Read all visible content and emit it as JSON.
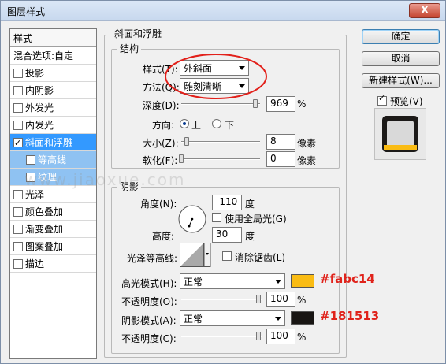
{
  "window": {
    "title": "图层样式",
    "close_glyph": "X"
  },
  "stylelist": {
    "header": "样式",
    "blend_options": "混合选项:自定",
    "items": [
      {
        "label": "投影",
        "checked": false
      },
      {
        "label": "内阴影",
        "checked": false
      },
      {
        "label": "外发光",
        "checked": false
      },
      {
        "label": "内发光",
        "checked": false
      },
      {
        "label": "斜面和浮雕",
        "checked": true,
        "active": true
      },
      {
        "label": "等高线",
        "checked": false,
        "sub": true
      },
      {
        "label": "纹理",
        "checked": false,
        "sub": true
      },
      {
        "label": "光泽",
        "checked": false
      },
      {
        "label": "颜色叠加",
        "checked": false
      },
      {
        "label": "渐变叠加",
        "checked": false
      },
      {
        "label": "图案叠加",
        "checked": false
      },
      {
        "label": "描边",
        "checked": false
      }
    ]
  },
  "bevel": {
    "title": "斜面和浮雕",
    "structure": {
      "title": "结构",
      "style_label": "样式(T):",
      "style_value": "外斜面",
      "technique_label": "方法(Q):",
      "technique_value": "雕刻清晰",
      "depth_label": "深度(D):",
      "depth_value": "969",
      "depth_unit": "%",
      "direction_label": "方向:",
      "dir_up": "上",
      "dir_down": "下",
      "size_label": "大小(Z):",
      "size_value": "8",
      "size_unit": "像素",
      "soften_label": "软化(F):",
      "soften_value": "0",
      "soften_unit": "像素"
    },
    "shading": {
      "title": "阴影",
      "angle_label": "角度(N):",
      "angle_value": "-110",
      "angle_unit": "度",
      "global_light_label": "使用全局光(G)",
      "altitude_label": "高度:",
      "altitude_value": "30",
      "altitude_unit": "度",
      "gloss_label": "光泽等高线:",
      "antialias_label": "消除锯齿(L)",
      "highlight_label": "高光模式(H):",
      "highlight_mode": "正常",
      "highlight_color": "#fabc14",
      "highlight_hex": "#fabc14",
      "hl_opacity_label": "不透明度(O):",
      "hl_opacity_value": "100",
      "hl_opacity_unit": "%",
      "shadow_label": "阴影模式(A):",
      "shadow_mode": "正常",
      "shadow_color": "#181513",
      "shadow_hex": "#181513",
      "sh_opacity_label": "不透明度(C):",
      "sh_opacity_value": "100",
      "sh_opacity_unit": "%"
    }
  },
  "buttons": {
    "ok": "确定",
    "cancel": "取消",
    "new_style": "新建样式(W)...",
    "preview": "预览(V)"
  },
  "watermark": "www.jiaoxue.com"
}
